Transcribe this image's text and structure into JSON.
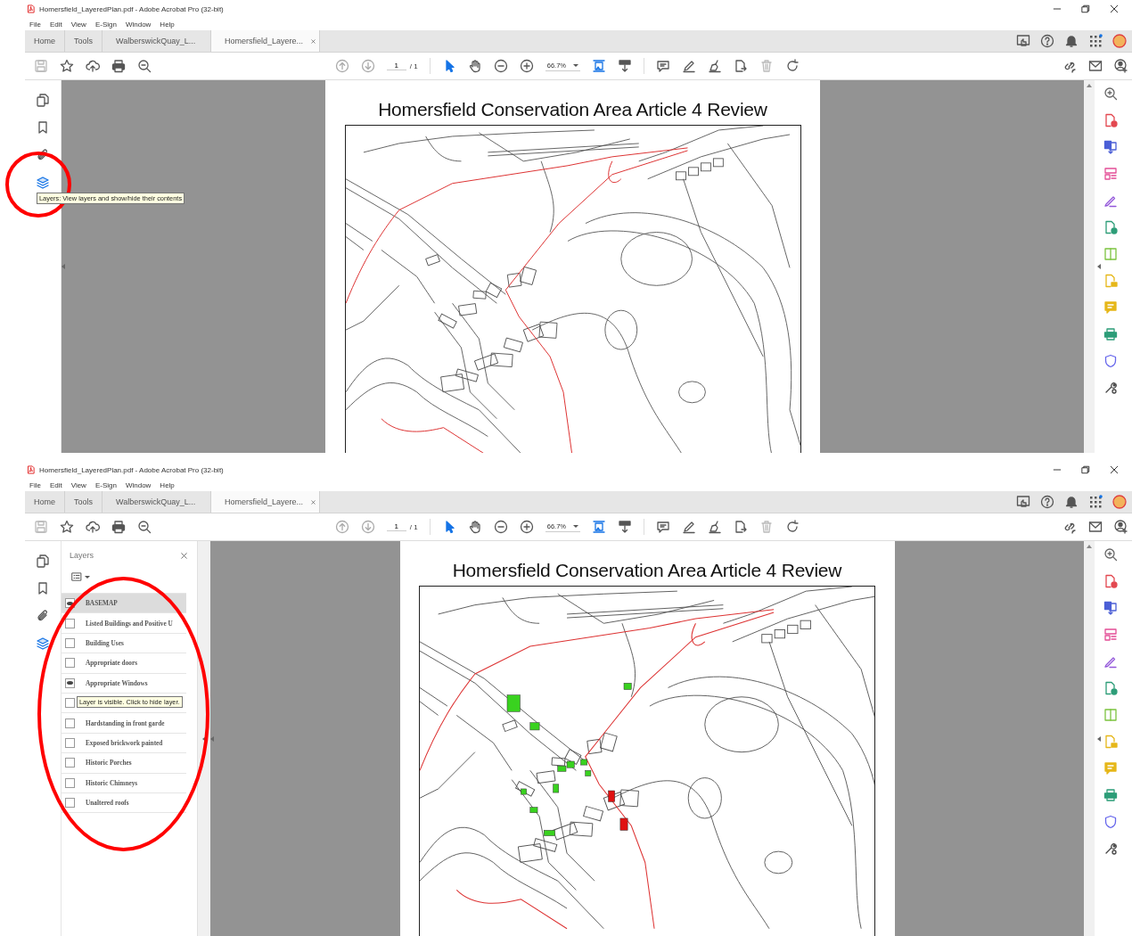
{
  "screens": [
    {
      "window_title": "Homersfield_LayeredPlan.pdf - Adobe Acrobat Pro (32-bit)",
      "menu": [
        "File",
        "Edit",
        "View",
        "E-Sign",
        "Window",
        "Help"
      ],
      "tabs": [
        {
          "label": "Home",
          "selected": false,
          "closable": false
        },
        {
          "label": "Tools",
          "selected": false,
          "closable": false
        },
        {
          "label": "WalberswickQuay_L...",
          "selected": false,
          "closable": false
        },
        {
          "label": "Homersfield_Layere...",
          "selected": true,
          "closable": true
        }
      ],
      "page_number": "1",
      "page_count": "/ 1",
      "zoom": "66.7%",
      "side_rail": [
        {
          "kind": "pages",
          "selected": false
        },
        {
          "kind": "bookmarks",
          "selected": false
        },
        {
          "kind": "attachments",
          "selected": false
        },
        {
          "kind": "layers",
          "selected": true
        }
      ],
      "rail_tooltip": "Layers: View layers and show/hide their contents",
      "document": {
        "title": "Homersfield Conservation Area Article 4 Review"
      },
      "highlight": true
    },
    {
      "window_title": "Homersfield_LayeredPlan.pdf - Adobe Acrobat Pro (32-bit)",
      "menu": [
        "File",
        "Edit",
        "View",
        "E-Sign",
        "Window",
        "Help"
      ],
      "tabs": [
        {
          "label": "Home",
          "selected": false,
          "closable": false
        },
        {
          "label": "Tools",
          "selected": false,
          "closable": false
        },
        {
          "label": "WalberswickQuay_L...",
          "selected": false,
          "closable": false
        },
        {
          "label": "Homersfield_Layere...",
          "selected": true,
          "closable": true
        }
      ],
      "page_number": "1",
      "page_count": "/ 1",
      "zoom": "66.7%",
      "side_rail": [
        {
          "kind": "pages",
          "selected": false
        },
        {
          "kind": "bookmarks",
          "selected": false
        },
        {
          "kind": "attachments",
          "selected": false
        },
        {
          "kind": "layers",
          "selected": true
        }
      ],
      "layers_panel": {
        "title": "Layers",
        "tooltip": "Layer is visible. Click to hide layer.",
        "layers": [
          {
            "label": "BASEMAP",
            "visible": true,
            "selected": true
          },
          {
            "label": "Listed Buildings and Positive U",
            "visible": false,
            "selected": false
          },
          {
            "label": "Building Uses",
            "visible": false,
            "selected": false
          },
          {
            "label": "Appropriate doors",
            "visible": false,
            "selected": false
          },
          {
            "label": "Appropriate Windows",
            "visible": true,
            "selected": false
          },
          {
            "visible": false,
            "selected": false
          },
          {
            "label": "Hardstanding in front garde",
            "visible": false,
            "selected": false
          },
          {
            "label": "Exposed brickwork painted",
            "visible": false,
            "selected": false
          },
          {
            "label": "Historic Porches",
            "visible": false,
            "selected": false
          },
          {
            "label": "Historic Chimneys",
            "visible": false,
            "selected": false
          },
          {
            "label": "Unaltered roofs",
            "visible": false,
            "selected": false
          }
        ]
      },
      "document": {
        "title": "Homersfield Conservation Area Article 4 Review"
      },
      "highlight": true
    }
  ]
}
